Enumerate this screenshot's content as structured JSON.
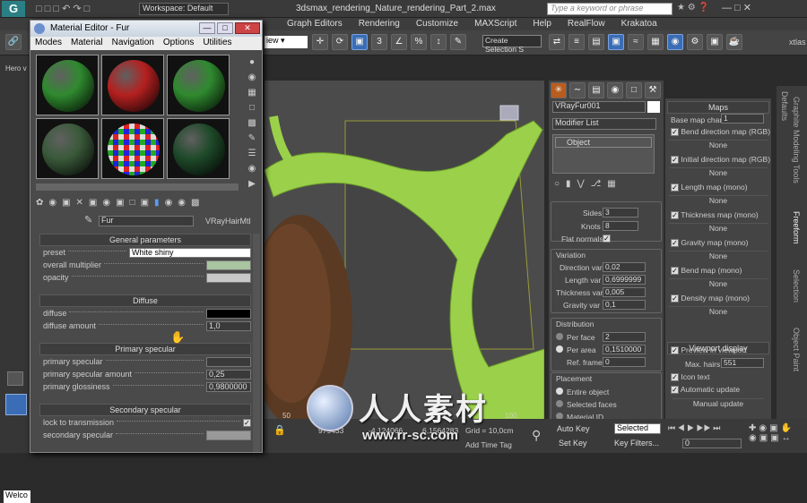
{
  "app": {
    "title": "3dsmax_rendering_Nature_rendering_Part_2.max",
    "workspace": "Workspace: Default",
    "search_placeholder": "Type a keyword or phrase",
    "left_label": "Hero v",
    "bottom_left": "Welco"
  },
  "main_menu": [
    "Graph Editors",
    "Rendering",
    "Customize",
    "MAXScript",
    "Help",
    "RealFlow",
    "Krakatoa"
  ],
  "toolbar": {
    "view_dropdown": "iew",
    "selection_set": "Create Selection S",
    "right_label": "xtlas"
  },
  "material_editor": {
    "title": "Material Editor - Fur",
    "menu": [
      "Modes",
      "Material",
      "Navigation",
      "Options",
      "Utilities"
    ],
    "material_name": "Fur",
    "material_type": "VRayHairMtl",
    "general": {
      "header": "General parameters",
      "preset_label": "preset",
      "preset_value": "White shiny",
      "overall_multiplier": "overall multiplier",
      "opacity": "opacity"
    },
    "diffuse": {
      "header": "Diffuse",
      "diffuse_label": "diffuse",
      "diffuse_amount_label": "diffuse amount",
      "diffuse_amount": "1,0"
    },
    "primary_specular": {
      "header": "Primary specular",
      "label": "primary specular",
      "amount_label": "primary specular amount",
      "amount": "0,25",
      "gloss_label": "primary glossiness",
      "gloss": "0,9800000"
    },
    "secondary_specular": {
      "header": "Secondary specular",
      "lock_label": "lock to transmission",
      "label": "secondary specular"
    },
    "sphere_colors": [
      "#2f8a2f",
      "#b52020",
      "#2f8a2f",
      "#3a5a3a",
      "checker",
      "#1f4a2a"
    ]
  },
  "command_panel": {
    "object_name": "VRayFur001",
    "modifier_list": "Modifier List",
    "stack_item": "Object",
    "sides_label": "Sides",
    "sides": "3",
    "knots_label": "Knots",
    "knots": "8",
    "flat_normals": "Flat normals",
    "variation_header": "Variation",
    "direction_var_label": "Direction var",
    "direction_var": "0,02",
    "length_var_label": "Length var",
    "length_var": "0,6999999",
    "thickness_var_label": "Thickness var",
    "thickness_var": "0,005",
    "gravity_var_label": "Gravity var",
    "gravity_var": "0,1",
    "distribution_header": "Distribution",
    "per_face_label": "Per face",
    "per_face": "2",
    "per_area_label": "Per area",
    "per_area": "0,1510000",
    "ref_frame_label": "Ref. frame",
    "ref_frame": "0",
    "placement_header": "Placement",
    "entire_object": "Entire object",
    "selected_faces": "Selected faces",
    "material_id": "Material ID"
  },
  "maps": {
    "header": "Maps",
    "base_map_chan_label": "Base map chan",
    "base_map_chan": "1",
    "items": [
      "Bend direction map (RGB)",
      "Initial direction map (RGB)",
      "Length map (mono)",
      "Thickness map (mono)",
      "Gravity map (mono)",
      "Bend map (mono)",
      "Density map (mono)"
    ],
    "none_label": "None",
    "viewport_header": "Viewport display",
    "preview": "Preview in viewport",
    "max_hairs_label": "Max. hairs",
    "max_hairs": "551",
    "icon_text": "Icon text",
    "auto_update": "Automatic update",
    "manual_update": "Manual update"
  },
  "side_tabs": [
    "Defaults",
    "Graphite Modeling Tools",
    "Freeform",
    "Selection",
    "Object Paint"
  ],
  "status": {
    "frame": "50",
    "frame2": "100",
    "x": "979433",
    "y": "-4,124066",
    "z": "6,1564283",
    "grid": "Grid = 10,0cm",
    "add_time_tag": "Add Time Tag",
    "auto_key": "Auto Key",
    "selected": "Selected",
    "set_key": "Set Key",
    "key_filters": "Key Filters...",
    "frame_field": "0"
  },
  "watermark": {
    "cn": "人人素材",
    "url": "www.rr-sc.com"
  },
  "colors": {
    "accent": "#3a6db5",
    "stem_green": "#9bd14a",
    "viewport_bg": "#4b4b4b"
  }
}
